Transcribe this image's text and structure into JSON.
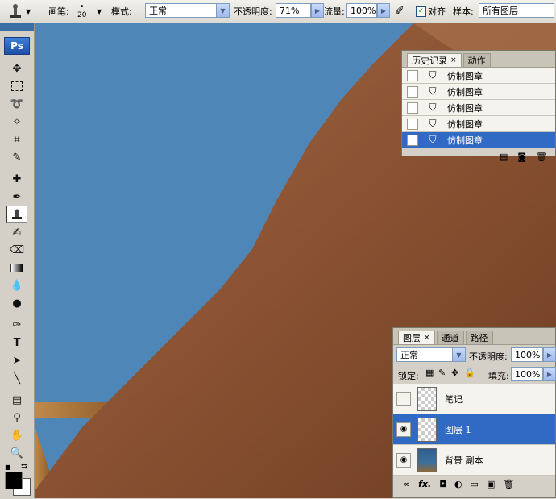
{
  "options_bar": {
    "brush_label": "画笔:",
    "brush_size": "20",
    "mode_label": "模式:",
    "mode_value": "正常",
    "opacity_label": "不透明度:",
    "opacity_value": "71%",
    "flow_label": "流量:",
    "flow_value": "100%",
    "aligned_label": "对齐",
    "aligned_checked": true,
    "sample_label": "样本:",
    "sample_value": "所有图层"
  },
  "toolbox": {
    "logo": "Ps",
    "tools": [
      "move",
      "marquee",
      "lasso",
      "magic-wand",
      "crop",
      "slice",
      "healing",
      "brush",
      "clone-stamp",
      "history-brush",
      "eraser",
      "gradient",
      "blur",
      "dodge",
      "pen",
      "type",
      "path-select",
      "line",
      "notes",
      "eyedropper",
      "hand",
      "zoom"
    ],
    "type_tool_glyph": "T"
  },
  "history_panel": {
    "tabs": [
      "历史记录",
      "动作"
    ],
    "items": [
      {
        "label": "仿制图章",
        "selected": false
      },
      {
        "label": "仿制图章",
        "selected": false
      },
      {
        "label": "仿制图章",
        "selected": false
      },
      {
        "label": "仿制图章",
        "selected": false
      },
      {
        "label": "仿制图章",
        "selected": true
      }
    ]
  },
  "layers_panel": {
    "tabs": [
      "图层",
      "通道",
      "路径"
    ],
    "blend_mode": "正常",
    "opacity_label": "不透明度:",
    "opacity_value": "100%",
    "lock_label": "锁定:",
    "fill_label": "填充:",
    "fill_value": "100%",
    "layers": [
      {
        "name": "笔记",
        "visible": false,
        "selected": false
      },
      {
        "name": "图层 1",
        "visible": true,
        "selected": true
      },
      {
        "name": "背景 副本",
        "visible": true,
        "selected": false
      }
    ],
    "footer_fx": "fx."
  },
  "colors": {
    "sky": "#4f86b8",
    "skin_dark": "#8a5232",
    "selection": "#316ac5"
  }
}
